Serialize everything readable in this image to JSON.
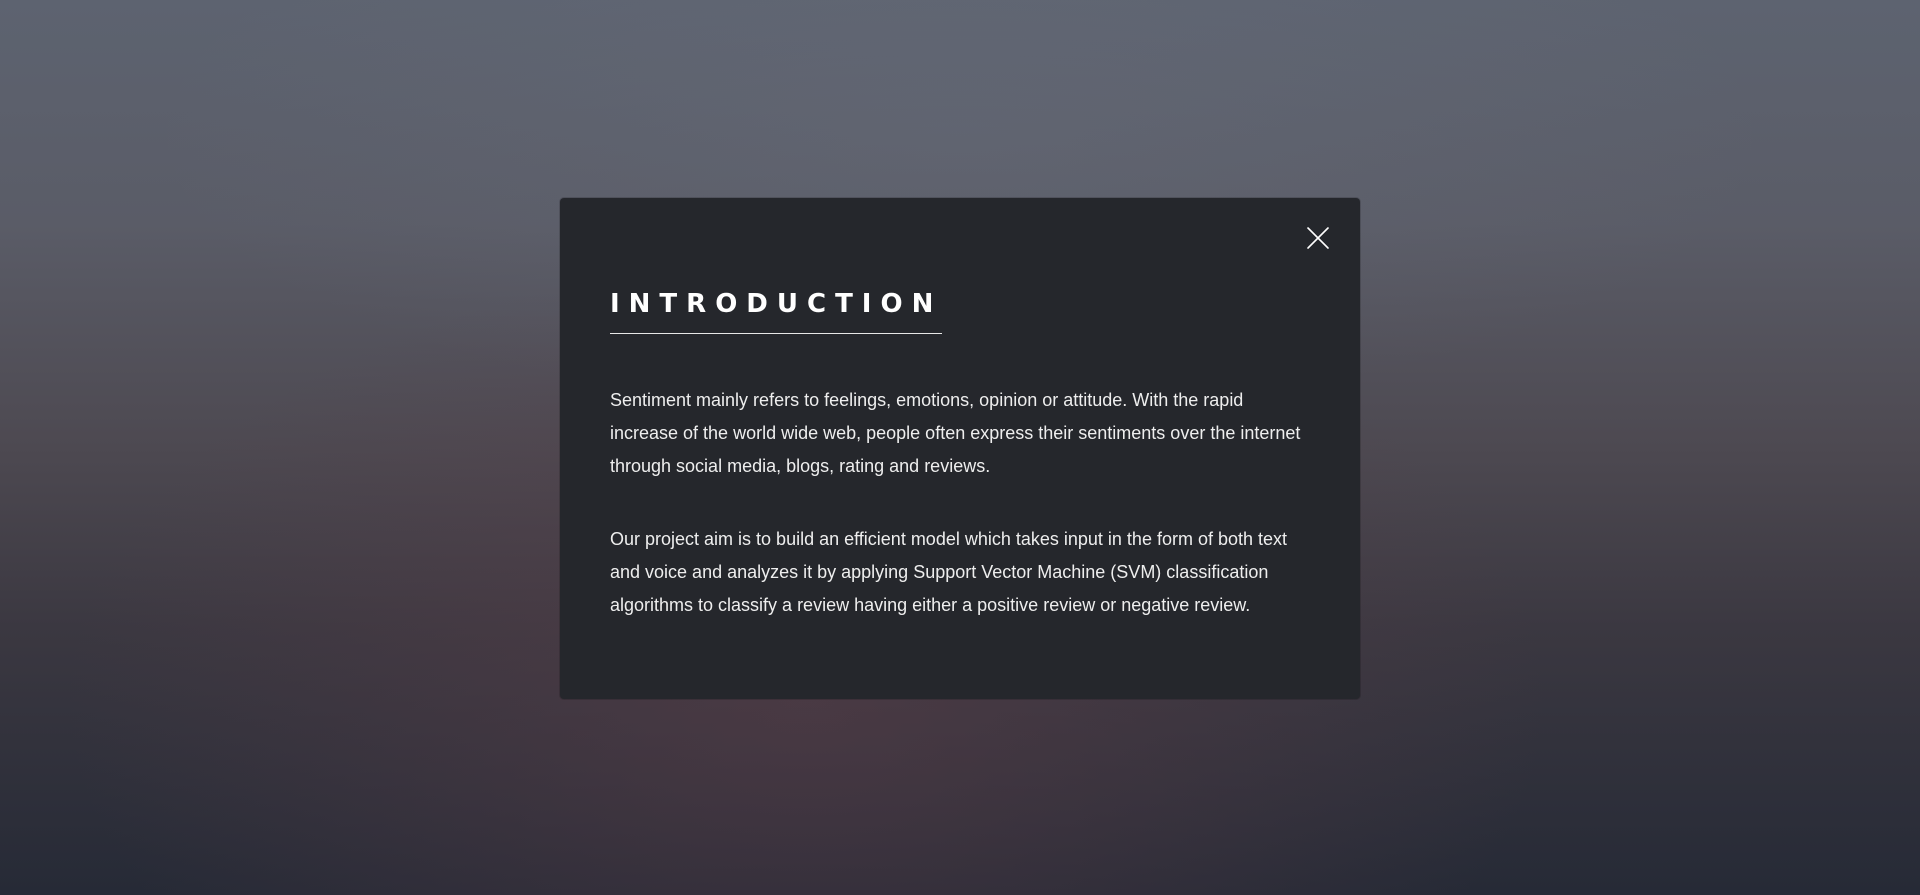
{
  "modal": {
    "title": "Introduction",
    "paragraphs": [
      "Sentiment mainly refers to feelings, emotions, opinion or attitude. With the rapid increase of the world wide web, people often express their sentiments over the internet through social media, blogs, rating and reviews.",
      "Our project aim is to build an efficient model which takes input in the form of both text and voice and analyzes it by applying Support Vector Machine (SVM) classification algorithms to classify a review having either a positive review or negative review."
    ],
    "close_icon": "close-icon"
  },
  "colors": {
    "modal_background": "#25272c",
    "text": "#eeeeee",
    "title": "#ffffff"
  }
}
